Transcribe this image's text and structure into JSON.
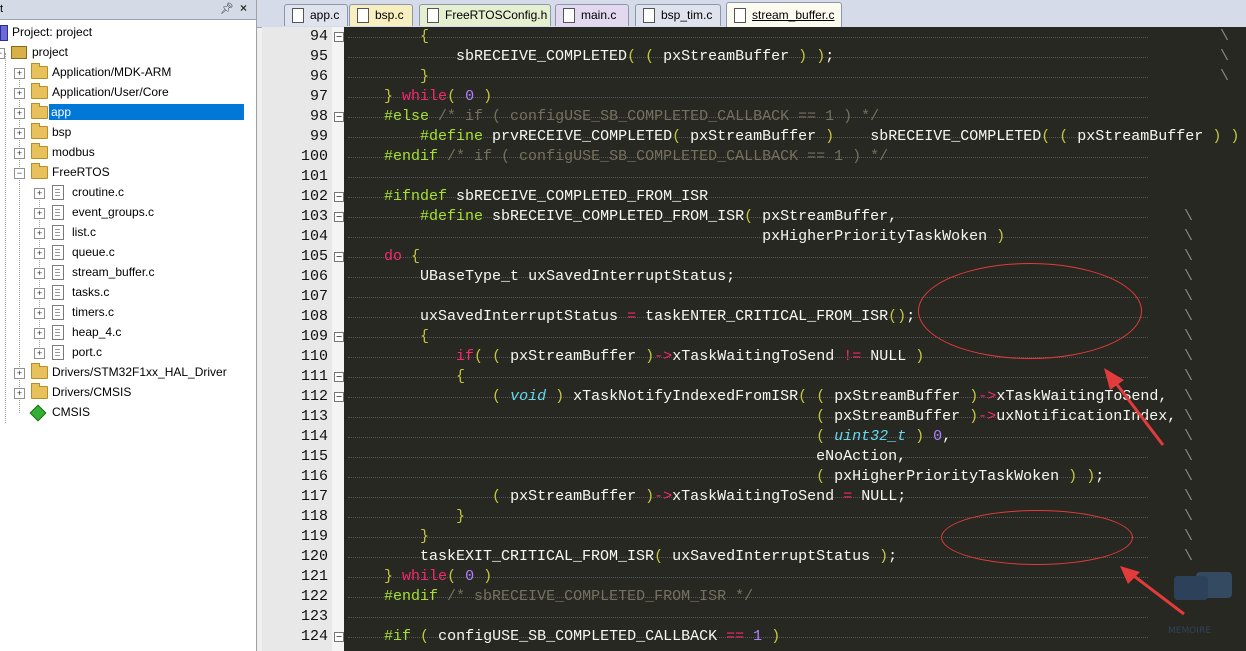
{
  "project_panel": {
    "title": "t",
    "pin_icon": "pin-icon",
    "close_icon": "close-icon",
    "tree": [
      {
        "label": "Project: project",
        "icon": "project-target-icon"
      },
      {
        "label": "project",
        "icon": "project-folder-icon"
      },
      {
        "label": "Application/MDK-ARM",
        "icon": "folder-icon"
      },
      {
        "label": "Application/User/Core",
        "icon": "folder-icon"
      },
      {
        "label": "app",
        "icon": "folder-icon",
        "selected": true
      },
      {
        "label": "bsp",
        "icon": "folder-icon"
      },
      {
        "label": "modbus",
        "icon": "folder-icon"
      },
      {
        "label": "FreeRTOS",
        "icon": "folder-icon",
        "expanded": true
      },
      {
        "label": "croutine.c",
        "icon": "file-icon"
      },
      {
        "label": "event_groups.c",
        "icon": "file-icon"
      },
      {
        "label": "list.c",
        "icon": "file-icon"
      },
      {
        "label": "queue.c",
        "icon": "file-icon"
      },
      {
        "label": "stream_buffer.c",
        "icon": "file-icon"
      },
      {
        "label": "tasks.c",
        "icon": "file-icon"
      },
      {
        "label": "timers.c",
        "icon": "file-icon"
      },
      {
        "label": "heap_4.c",
        "icon": "file-icon"
      },
      {
        "label": "port.c",
        "icon": "file-icon"
      },
      {
        "label": "Drivers/STM32F1xx_HAL_Driver",
        "icon": "folder-icon"
      },
      {
        "label": "Drivers/CMSIS",
        "icon": "folder-icon"
      },
      {
        "label": "CMSIS",
        "icon": "cmsis-diamond-icon"
      }
    ]
  },
  "tabs": [
    {
      "label": "app.c",
      "color": "#dfe3ee"
    },
    {
      "label": "bsp.c",
      "color": "#f7efbf"
    },
    {
      "label": "FreeRTOSConfig.h",
      "color": "#e4f0d0"
    },
    {
      "label": "main.c",
      "color": "#e2d8f0"
    },
    {
      "label": "bsp_tim.c",
      "color": "#dfe3ee"
    },
    {
      "label": "stream_buffer.c",
      "color": "#fbfbf0",
      "active": true
    }
  ],
  "editor": {
    "lines": [
      {
        "n": "94",
        "code": "        {",
        "fold": "-"
      },
      {
        "n": "95",
        "code": "            sbRECEIVE_COMPLETED( ( pxStreamBuffer ) );"
      },
      {
        "n": "96",
        "code": "        }"
      },
      {
        "n": "97",
        "code": "    } while( 0 )"
      },
      {
        "n": "98",
        "code": "    #else /* if ( configUSE_SB_COMPLETED_CALLBACK == 1 ) */",
        "fold": "-"
      },
      {
        "n": "99",
        "code": "        #define prvRECEIVE_COMPLETED( pxStreamBuffer )    sbRECEIVE_COMPLETED( ( pxStreamBuffer ) )"
      },
      {
        "n": "100",
        "code": "    #endif /* if ( configUSE_SB_COMPLETED_CALLBACK == 1 ) */"
      },
      {
        "n": "101",
        "code": ""
      },
      {
        "n": "102",
        "code": "    #ifndef sbRECEIVE_COMPLETED_FROM_ISR",
        "fold": "-"
      },
      {
        "n": "103",
        "code": "        #define sbRECEIVE_COMPLETED_FROM_ISR( pxStreamBuffer,",
        "fold": "-"
      },
      {
        "n": "104",
        "code": "                                              pxHigherPriorityTaskWoken )"
      },
      {
        "n": "105",
        "code": "    do {",
        "fold": "-"
      },
      {
        "n": "106",
        "code": "        UBaseType_t uxSavedInterruptStatus;"
      },
      {
        "n": "107",
        "code": ""
      },
      {
        "n": "108",
        "code": "        uxSavedInterruptStatus = taskENTER_CRITICAL_FROM_ISR();"
      },
      {
        "n": "109",
        "code": "        {",
        "fold": "-"
      },
      {
        "n": "110",
        "code": "            if( ( pxStreamBuffer )->xTaskWaitingToSend != NULL )"
      },
      {
        "n": "111",
        "code": "            {",
        "fold": "-"
      },
      {
        "n": "112",
        "code": "                ( void ) xTaskNotifyIndexedFromISR( ( pxStreamBuffer )->xTaskWaitingToSend,",
        "fold": "-"
      },
      {
        "n": "113",
        "code": "                                                    ( pxStreamBuffer )->uxNotificationIndex,"
      },
      {
        "n": "114",
        "code": "                                                    ( uint32_t ) 0,"
      },
      {
        "n": "115",
        "code": "                                                    eNoAction,"
      },
      {
        "n": "116",
        "code": "                                                    ( pxHigherPriorityTaskWoken ) );"
      },
      {
        "n": "117",
        "code": "                ( pxStreamBuffer )->xTaskWaitingToSend = NULL;"
      },
      {
        "n": "118",
        "code": "            }"
      },
      {
        "n": "119",
        "code": "        }"
      },
      {
        "n": "120",
        "code": "        taskEXIT_CRITICAL_FROM_ISR( uxSavedInterruptStatus );"
      },
      {
        "n": "121",
        "code": "    } while( 0 )"
      },
      {
        "n": "122",
        "code": "    #endif /* sbRECEIVE_COMPLETED_FROM_ISR */"
      },
      {
        "n": "123",
        "code": ""
      },
      {
        "n": "124",
        "code": "    #if ( configUSE_SB_COMPLETED_CALLBACK == 1 )",
        "fold": "-"
      }
    ]
  },
  "annotation_color": "#e23b3b",
  "watermark_text": "MEMOIRE"
}
